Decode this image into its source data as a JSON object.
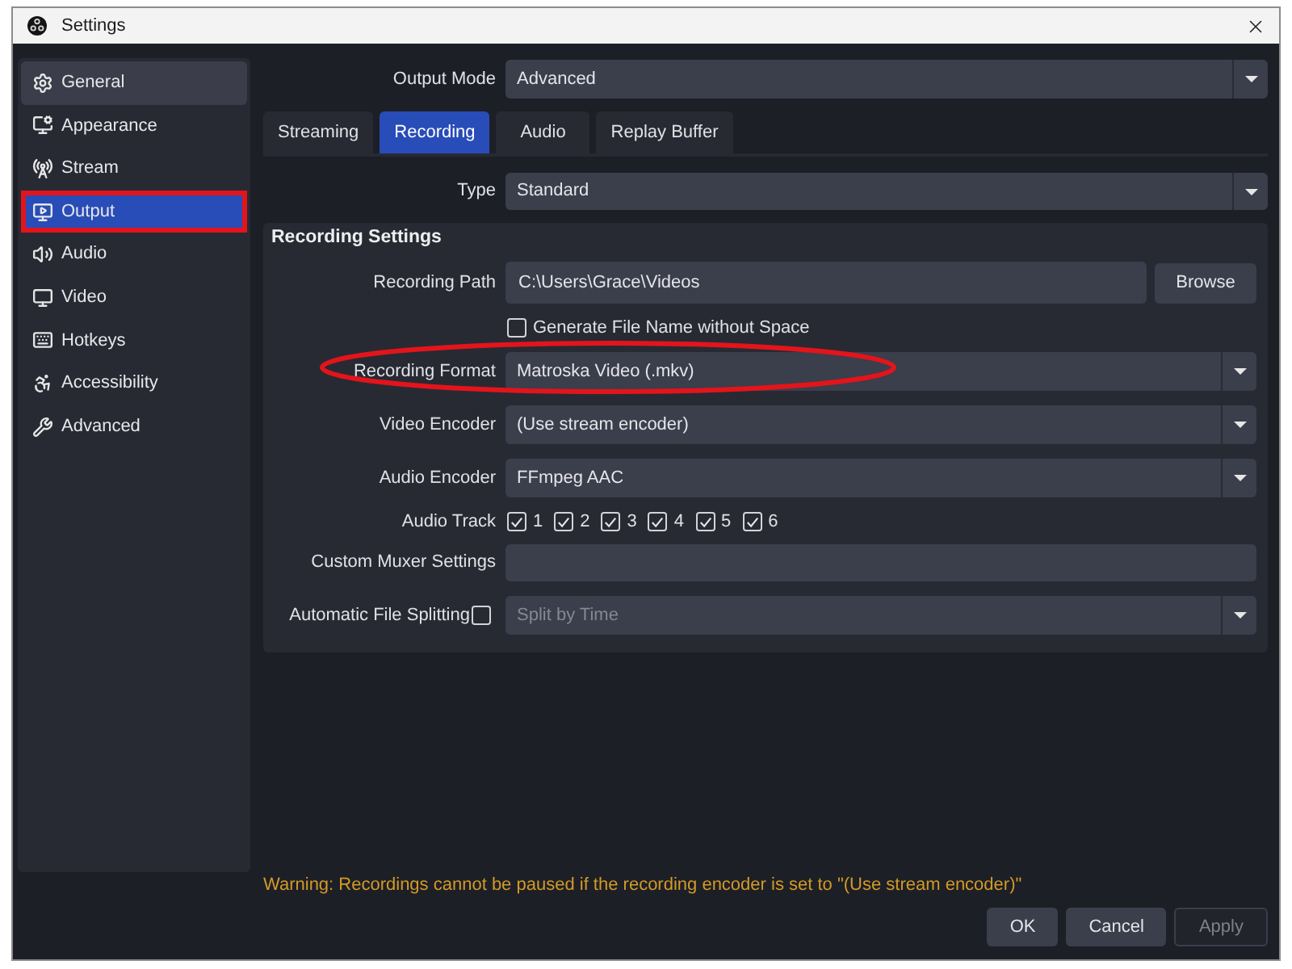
{
  "window": {
    "title": "Settings"
  },
  "sidebar": {
    "items": [
      {
        "label": "General",
        "selected": false,
        "highlighted": true,
        "annotated": false
      },
      {
        "label": "Appearance",
        "selected": false,
        "highlighted": false,
        "annotated": false
      },
      {
        "label": "Stream",
        "selected": false,
        "highlighted": false,
        "annotated": false
      },
      {
        "label": "Output",
        "selected": true,
        "highlighted": false,
        "annotated": true
      },
      {
        "label": "Audio",
        "selected": false,
        "highlighted": false,
        "annotated": false
      },
      {
        "label": "Video",
        "selected": false,
        "highlighted": false,
        "annotated": false
      },
      {
        "label": "Hotkeys",
        "selected": false,
        "highlighted": false,
        "annotated": false
      },
      {
        "label": "Accessibility",
        "selected": false,
        "highlighted": false,
        "annotated": false
      },
      {
        "label": "Advanced",
        "selected": false,
        "highlighted": false,
        "annotated": false
      }
    ]
  },
  "output_mode": {
    "label": "Output Mode",
    "value": "Advanced"
  },
  "tabs": [
    {
      "label": "Streaming",
      "selected": false
    },
    {
      "label": "Recording",
      "selected": true
    },
    {
      "label": "Audio",
      "selected": false
    },
    {
      "label": "Replay Buffer",
      "selected": false
    }
  ],
  "type": {
    "label": "Type",
    "value": "Standard"
  },
  "recording_settings": {
    "title": "Recording Settings",
    "rows": [
      {
        "kind": "path",
        "label": "Recording Path",
        "value": "C:\\Users\\Grace\\Videos",
        "button": "Browse"
      },
      {
        "kind": "checkbox",
        "label": "Generate File Name without Space",
        "checked": false
      },
      {
        "kind": "dropdown",
        "label": "Recording Format",
        "value": "Matroska Video (.mkv)",
        "annotated": true
      },
      {
        "kind": "dropdown",
        "label": "Video Encoder",
        "value": "(Use stream encoder)"
      },
      {
        "kind": "dropdown",
        "label": "Audio Encoder",
        "value": "FFmpeg AAC"
      },
      {
        "kind": "tracks",
        "label": "Audio Track",
        "tracks": [
          {
            "label": "1",
            "checked": true
          },
          {
            "label": "2",
            "checked": true
          },
          {
            "label": "3",
            "checked": true
          },
          {
            "label": "4",
            "checked": true
          },
          {
            "label": "5",
            "checked": true
          },
          {
            "label": "6",
            "checked": true
          }
        ]
      },
      {
        "kind": "text",
        "label": "Custom Muxer Settings"
      },
      {
        "kind": "split",
        "label": "Automatic File Splitting",
        "checked": false,
        "value": "Split by Time",
        "disabled": true
      }
    ]
  },
  "warning": "Warning: Recordings cannot be paused if the recording encoder is set to \"(Use stream encoder)\"",
  "buttons": [
    {
      "label": "OK",
      "disabled": false
    },
    {
      "label": "Cancel",
      "disabled": false
    },
    {
      "label": "Apply",
      "disabled": true
    }
  ]
}
